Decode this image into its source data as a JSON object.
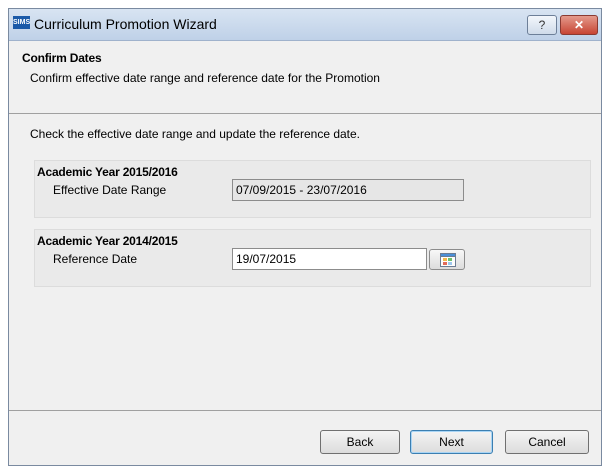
{
  "window": {
    "app_logo": "SIMS",
    "title": "Curriculum Promotion Wizard",
    "help_glyph": "?",
    "close_glyph": "✕"
  },
  "header": {
    "title": "Confirm Dates",
    "subtitle": "Confirm effective date range and reference date for the Promotion"
  },
  "instruction": "Check the effective date range and update the reference date.",
  "group_current": {
    "title": "Academic Year 2015/2016",
    "label": "Effective Date Range",
    "value": "07/09/2015 - 23/07/2016"
  },
  "group_previous": {
    "title": "Academic Year 2014/2015",
    "label": "Reference Date",
    "value": "19/07/2015",
    "calendar_icon": "calendar-icon"
  },
  "footer": {
    "back": "Back",
    "next": "Next",
    "cancel": "Cancel"
  }
}
